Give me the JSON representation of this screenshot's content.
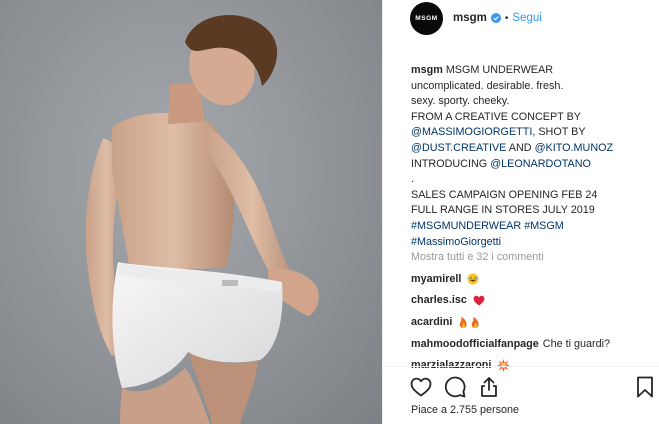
{
  "post": {
    "username": "msgm",
    "avatar_text": "MSGM",
    "follow_label": "Segui",
    "caption": {
      "first_line_text": "MSGM UNDERWEAR",
      "lines": [
        "uncomplicated. desirable. fresh.",
        "sexy. sporty. cheeky.",
        "FROM A CREATIVE CONCEPT BY"
      ],
      "line_shot_tag": "@MASSIMOGIORGETTI",
      "line_shot_text": ", SHOT BY",
      "line_and_tag1": "@DUST.CREATIVE",
      "line_and_text": " AND ",
      "line_and_tag2": "@KITO.MUNOZ",
      "line_intro_text": "INTRODUCING ",
      "line_intro_tag": "@LEONARDOTANO",
      "dot_line": ".",
      "sales_line": "SALES CAMPAIGN OPENING FEB 24",
      "range_line": "FULL RANGE IN STORES JULY 2019",
      "hashtag1": "#MSGMUNDERWEAR",
      "hashtag2": "#MSGM",
      "hashtag3": "#MassimoGiorgetti"
    },
    "view_all_comments": "Mostra tutti e 32 i commenti",
    "comments": [
      {
        "user": "myamirell",
        "text": "",
        "emoji": "laughing-emoji"
      },
      {
        "user": "charles.isc",
        "text": "",
        "emoji": "heart-emoji"
      },
      {
        "user": "acardini",
        "text": "",
        "emoji": "fire-emoji"
      },
      {
        "user": "mahmoodofficialfanpage",
        "text": "Che ti guardi?",
        "emoji": ""
      },
      {
        "user": "marzialazzaroni",
        "text": "",
        "emoji": "explosion-emoji"
      }
    ],
    "likes_text": "Piace a 2.755 persone",
    "colors": {
      "link": "#3897f0",
      "tag": "#003569",
      "muted": "#999999",
      "verified": "#3897f0"
    }
  }
}
